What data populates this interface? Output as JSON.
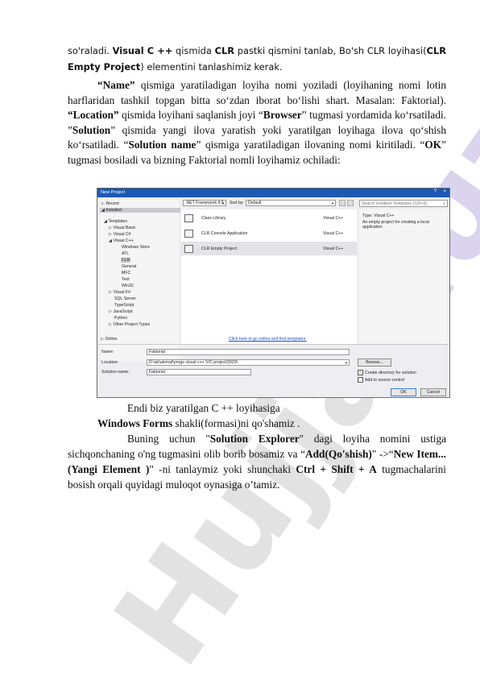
{
  "para1": {
    "t1": "so'raladi. ",
    "b1": "Visual C ++",
    "t2": " qismida ",
    "b2": "CLR",
    "t3": " pastki qismini tanlab, Bo'sh CLR loyihasi(",
    "b3": "CLR Empty Project",
    "t4": ") elementini tanlashimiz kerak."
  },
  "para2": {
    "b1": "“Name”",
    "t1": " qismiga yaratiladigan loyiha nomi yoziladi (loyihaning nomi lotin harflaridan tashkil topgan bitta so‘zdan iborat bo‘lishi shart. Masalan: Faktorial). ",
    "b2": "“Location”",
    "t2": " qismida loyihani saqlanish joyi “",
    "b3": "Browser",
    "t3": "” tugmasi yordamida ko‘rsatiladi. ”",
    "b4": "Solution",
    "t4": "” qismida yangi ilova yaratish yoki yaratilgan loyihaga ilova qo‘shish ko‘rsatiladi. “",
    "b5": "Solution name",
    "t5": "” qismiga yaratiladigan ilovaning nomi kiritiladi. “",
    "b6": "OK",
    "t6": "” tugmasi bosiladi va bizning Faktorial nomli loyihamiz ochiladi:"
  },
  "dialog": {
    "title": "New Project",
    "help": "?",
    "close": "×",
    "framework": ".NET Framework 4.5",
    "sortby_label": "Sort by:",
    "sortby_value": "Default",
    "search_placeholder": "Search Installed Templates (Ctrl+E)",
    "tree": {
      "recent": "Recent",
      "installed": "Installed",
      "templates": "Templates",
      "visual_basic": "Visual Basic",
      "visual_cs": "Visual C#",
      "visual_cpp": "Visual C++",
      "windows_store": "Windows Store",
      "atl": "ATL",
      "clr": "CLR",
      "general": "General",
      "mfc": "MFC",
      "test": "Test",
      "win32": "Win32",
      "visual_fs": "Visual F#",
      "sql_server": "SQL Server",
      "typescript": "TypeScript",
      "javascript": "JavaScript",
      "python": "Python",
      "other": "Other Project Types",
      "online": "Online"
    },
    "templates": [
      {
        "name": "Class Library",
        "lang": "Visual C++"
      },
      {
        "name": "CLR Console Application",
        "lang": "Visual C++"
      },
      {
        "name": "CLR Empty Project",
        "lang": "Visual C++"
      }
    ],
    "info_type": "Type:  Visual C++",
    "info_desc": "An empty project for creating a local application",
    "online_link": "Click here to go online and find templates.",
    "name_label": "Name:",
    "name_value": "Faktorial",
    "location_label": "Location:",
    "location_value": "D:\\ab\\alemaf\\progs visual c++ \\VC project\\2020\\",
    "solution_label": "Solution name:",
    "solution_value": "Faktorial",
    "browse": "Browse...",
    "chk_directory": "Create directory for solution",
    "chk_source": "Add to source control",
    "ok": "OK",
    "cancel": "Cancel"
  },
  "para3": {
    "l1": "Endi biz yaratilgan C ++ loyihasiga",
    "l2b": "Windows Forms",
    "l2t": " shakli(formasi)ni qo'shamiz .",
    "l3a": "Buning uchun \"",
    "l3b": "Solution Explorer",
    "l3c": "\" dagi loyiha nomini ustiga sichqonchaning o'ng tugmasini olib borib bosamiz va “",
    "l3d": "Add(Qo'shish)",
    "l3e": "\" ->“",
    "l3f": "New Item...(Yangi Element )",
    "l3g": "\" -ni tanlaymiz yoki shunchaki ",
    "l3h": "Ctrl + Shift + A",
    "l3i": " tugmachalarini bosish orqali quyidagi muloqot oynasiga o’tamiz."
  },
  "watermark": {
    "w1": "Hujjat",
    "w2": ".uz"
  }
}
